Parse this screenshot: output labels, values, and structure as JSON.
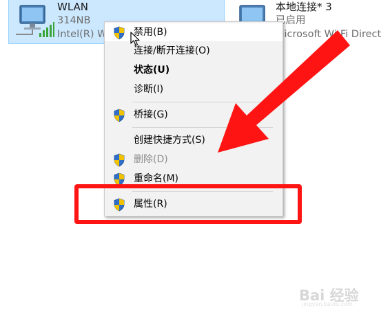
{
  "adapters": [
    {
      "name": "WLAN",
      "line1": "314NB",
      "line2": "Intel(R) W",
      "selected": true
    },
    {
      "name": "本地连接* 3",
      "line1": "已启用",
      "line2": "Microsoft Wi-Fi Direct",
      "selected": false
    }
  ],
  "context_menu": {
    "items": [
      {
        "label": "禁用(B)",
        "shield": true,
        "bold": false,
        "disabled": false,
        "hover": true
      },
      {
        "label": "连接/断开连接(O)",
        "shield": false,
        "bold": false,
        "disabled": false
      },
      {
        "label": "状态(U)",
        "shield": false,
        "bold": true,
        "disabled": false
      },
      {
        "label": "诊断(I)",
        "shield": false,
        "bold": false,
        "disabled": false
      },
      {
        "label": "桥接(G)",
        "shield": true,
        "bold": false,
        "disabled": false
      },
      {
        "label": "创建快捷方式(S)",
        "shield": false,
        "bold": false,
        "disabled": false
      },
      {
        "label": "删除(D)",
        "shield": true,
        "bold": false,
        "disabled": true
      },
      {
        "label": "重命名(M)",
        "shield": true,
        "bold": false,
        "disabled": false
      },
      {
        "label": "属性(R)",
        "shield": true,
        "bold": false,
        "disabled": false
      }
    ]
  },
  "annotation": {
    "color": "#ff1414",
    "highlighted_item": "属性(R)"
  },
  "watermark": {
    "text": "Bai 经验",
    "sub": "jingyan.baidu.com"
  },
  "icons": {
    "adapter": "network-adapter-icon",
    "signal": "wifi-signal-bars-icon",
    "shield": "uac-shield-icon",
    "cursor": "mouse-pointer-icon"
  }
}
